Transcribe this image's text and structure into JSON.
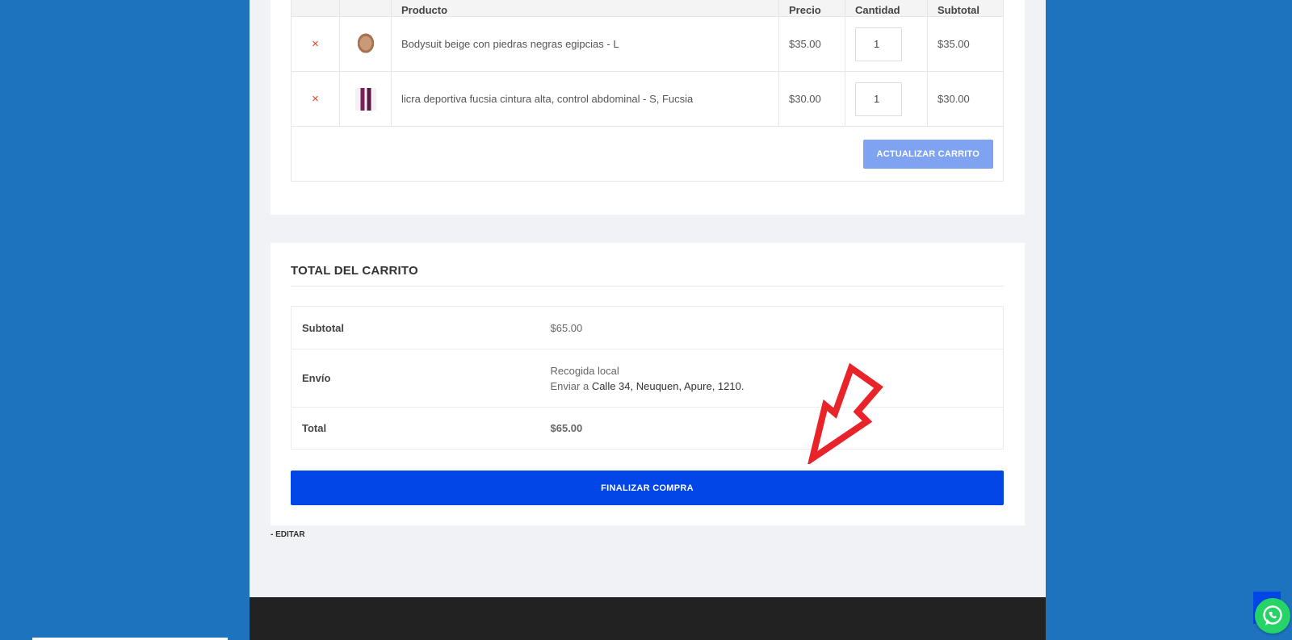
{
  "cart": {
    "headers": [
      "",
      "",
      "Producto",
      "Precio",
      "Cantidad",
      "Subtotal"
    ],
    "items": [
      {
        "name": "Bodysuit beige con piedras negras egipcias - L",
        "price": "$35.00",
        "qty": "1",
        "subtotal": "$35.00",
        "remove": "×"
      },
      {
        "name": "licra deportiva fucsia cintura alta, control abdominal - S, Fucsia",
        "price": "$30.00",
        "qty": "1",
        "subtotal": "$30.00",
        "remove": "×"
      }
    ],
    "update_label": "ACTUALIZAR CARRITO"
  },
  "totals": {
    "title": "TOTAL DEL CARRITO",
    "subtotal_label": "Subtotal",
    "subtotal_value": "$65.00",
    "shipping_label": "Envío",
    "shipping_method": "Recogida local",
    "ship_to_prefix": "Enviar a ",
    "ship_to_address": "Calle 34, Neuquen, Apure, 1210.",
    "total_label": "Total",
    "total_value": "$65.00",
    "checkout_label": "FINALIZAR COMPRA"
  },
  "edit_link": "- EDITAR",
  "colors": {
    "background": "#1e73be",
    "checkout_button": "#0346e8",
    "update_button": "#7fa3f0",
    "arrow": "#e8232a",
    "whatsapp": "#25d366"
  },
  "icons": [
    "remove-icon",
    "arrow-annotation-icon",
    "whatsapp-icon",
    "scroll-top-icon"
  ]
}
